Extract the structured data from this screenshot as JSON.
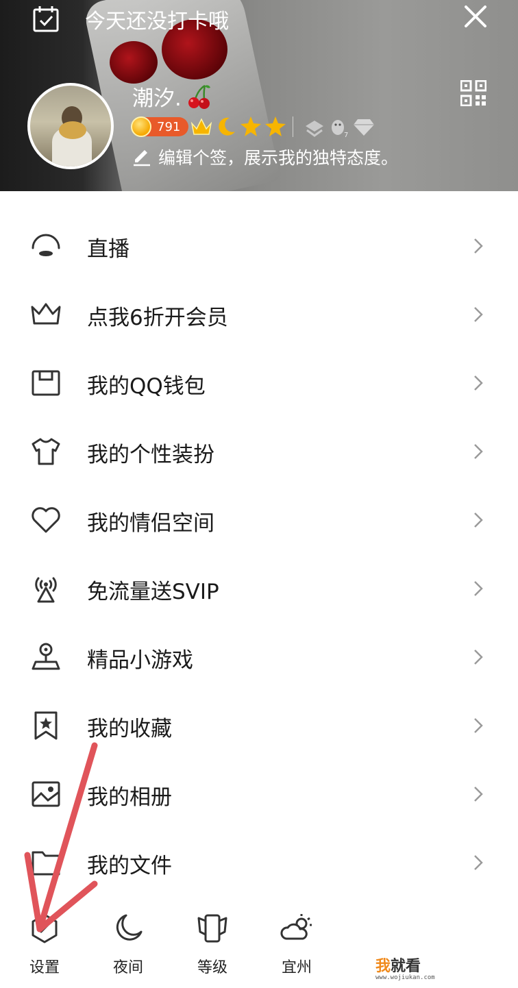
{
  "header": {
    "checkin_text": "今天还没打卡哦",
    "nickname": "潮汐.",
    "level": "791",
    "signature": "编辑个签，展示我的独特态度。"
  },
  "menu": {
    "items": [
      {
        "label": "直播",
        "icon": "live-icon"
      },
      {
        "label": "点我6折开会员",
        "icon": "crown-icon"
      },
      {
        "label": "我的QQ钱包",
        "icon": "wallet-icon"
      },
      {
        "label": "我的个性装扮",
        "icon": "tshirt-icon"
      },
      {
        "label": "我的情侣空间",
        "icon": "heart-icon"
      },
      {
        "label": "免流量送SVIP",
        "icon": "signal-tower-icon"
      },
      {
        "label": "精品小游戏",
        "icon": "joystick-icon"
      },
      {
        "label": "我的收藏",
        "icon": "bookmark-star-icon"
      },
      {
        "label": "我的相册",
        "icon": "photo-album-icon"
      },
      {
        "label": "我的文件",
        "icon": "folder-icon"
      }
    ]
  },
  "bottom_bar": {
    "tabs": [
      {
        "label": "设置",
        "icon": "settings-hexagon-icon"
      },
      {
        "label": "夜间",
        "icon": "moon-icon"
      },
      {
        "label": "等级",
        "icon": "level-card-icon"
      },
      {
        "label": "宜州",
        "icon": "weather-cloud-sun-icon"
      }
    ]
  },
  "watermark": {
    "main_accent": "我",
    "main_rest": "就看",
    "sub": "www.wojiukan.com"
  },
  "colors": {
    "annotation_arrow": "#e0545a",
    "level_pill": "#e85a2a",
    "watermark_accent": "#f08a1c"
  }
}
